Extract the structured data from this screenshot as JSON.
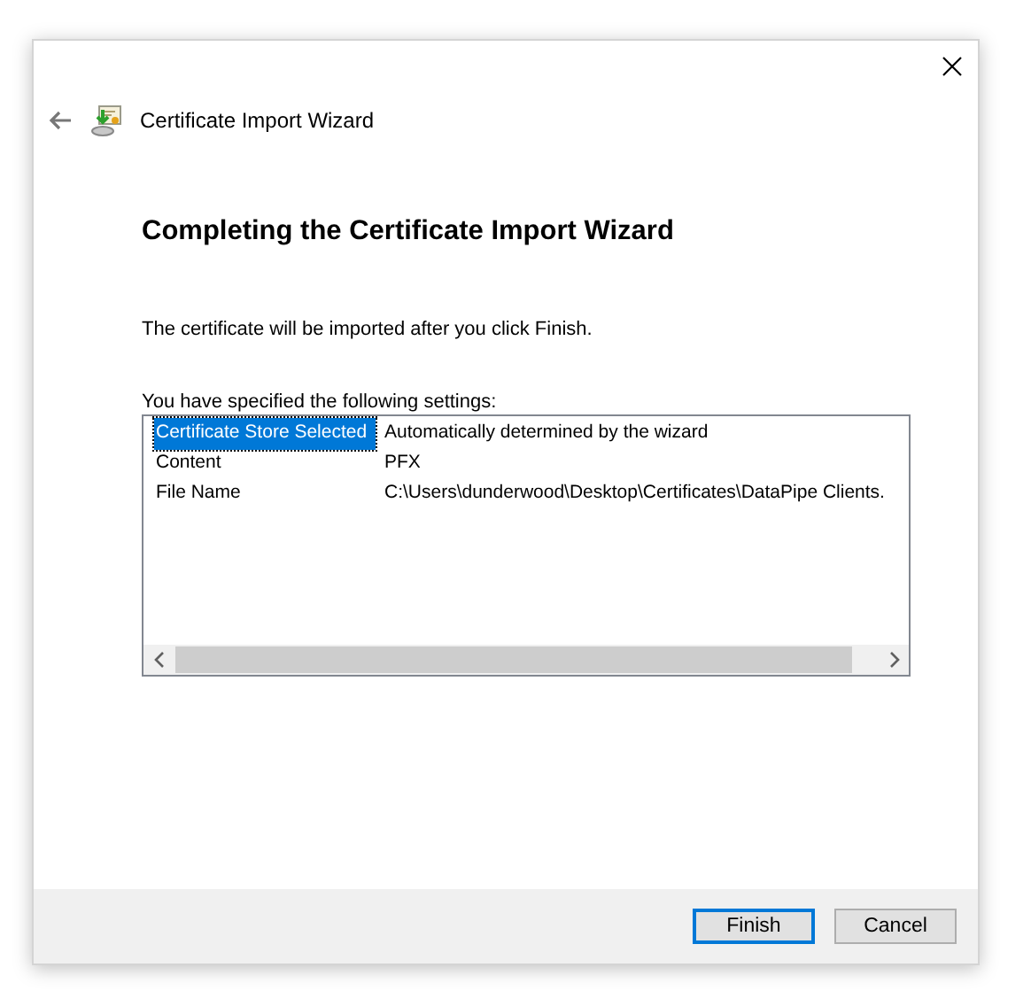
{
  "window": {
    "title": "Certificate Import Wizard"
  },
  "heading": "Completing the Certificate Import Wizard",
  "intro": "The certificate will be imported after you click Finish.",
  "settings_label": "You have specified the following settings:",
  "settings": [
    {
      "name": "Certificate Store Selected",
      "value": "Automatically determined by the wizard",
      "selected": true
    },
    {
      "name": "Content",
      "value": "PFX",
      "selected": false
    },
    {
      "name": "File Name",
      "value": "C:\\Users\\dunderwood\\Desktop\\Certificates\\DataPipe Clients.",
      "selected": false
    }
  ],
  "buttons": [
    {
      "label": "Finish",
      "default": true
    },
    {
      "label": "Cancel",
      "default": false
    }
  ]
}
